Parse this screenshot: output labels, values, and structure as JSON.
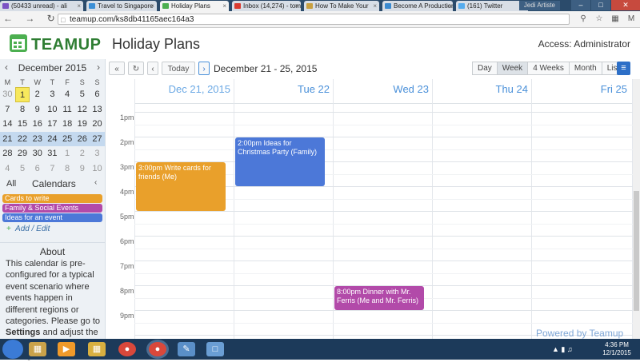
{
  "browser": {
    "tabs": [
      {
        "label": "(50433 unread) - ali",
        "icon_color": "#7b52c4"
      },
      {
        "label": "Travel to Singapore",
        "icon_color": "#3b8fd6"
      },
      {
        "label": "Holiday Plans",
        "icon_color": "#4caf50",
        "active": true
      },
      {
        "label": "Inbox (14,274) - tom",
        "icon_color": "#d93b30"
      },
      {
        "label": "How To Make Your",
        "icon_color": "#c8a040"
      },
      {
        "label": "Become A Production",
        "icon_color": "#3a8ad0"
      },
      {
        "label": "(161) Twitter",
        "icon_color": "#55acee"
      }
    ],
    "user_chip": "Jedi Artiste",
    "url": "teamup.com/ks8db41165aec164a3",
    "nav": "← → ↻"
  },
  "app": {
    "brand": "TEAMUP",
    "calendar_title": "Holiday Plans",
    "access": "Access: Administrator"
  },
  "mini_calendar": {
    "month_label": "December 2015",
    "prev": "‹",
    "next": "›",
    "weekdays": [
      "M",
      "T",
      "W",
      "T",
      "F",
      "S",
      "S"
    ],
    "weeks": [
      [
        "30",
        "1",
        "2",
        "3",
        "4",
        "5",
        "6"
      ],
      [
        "7",
        "8",
        "9",
        "10",
        "11",
        "12",
        "13"
      ],
      [
        "14",
        "15",
        "16",
        "17",
        "18",
        "19",
        "20"
      ],
      [
        "21",
        "22",
        "23",
        "24",
        "25",
        "26",
        "27"
      ],
      [
        "28",
        "29",
        "30",
        "31",
        "1",
        "2",
        "3"
      ],
      [
        "4",
        "5",
        "6",
        "7",
        "8",
        "9",
        "10"
      ]
    ],
    "today": "1"
  },
  "calendars": {
    "all_label": "All",
    "title": "Calendars",
    "toggle": "‹",
    "items": [
      {
        "label": "Cards to write",
        "color": "#e9a02b"
      },
      {
        "label": "Family & Social Events",
        "color": "#b24aa9"
      },
      {
        "label": "Ideas for an event",
        "color": "#4c78d8"
      }
    ],
    "add_edit": "Add / Edit"
  },
  "about": {
    "title": "About",
    "text_before": "This calendar is pre-configured for a typical event scenario where events happen in different regions or categories. Please go to ",
    "settings_word": "Settings",
    "text_after": " and adjust the following configuration settings to"
  },
  "toolbar": {
    "collapse": "«",
    "refresh": "↻",
    "prev": "‹",
    "today": "Today",
    "next": "›",
    "range": "December 21 - 25, 2015",
    "views": [
      "Day",
      "Week",
      "4 Weeks",
      "Month",
      "List"
    ],
    "active_view": "Week",
    "menu": "≡"
  },
  "week": {
    "days": [
      "Dec 21, 2015",
      "Tue 22",
      "Wed 23",
      "Thu 24",
      "Fri 25"
    ],
    "hours": [
      "1pm",
      "2pm",
      "3pm",
      "4pm",
      "5pm",
      "6pm",
      "7pm",
      "8pm",
      "9pm"
    ],
    "events": [
      {
        "day": 0,
        "start": 15,
        "end": 17,
        "title": "3:00pm Write cards for friends (Me)",
        "color": "#e9a02b"
      },
      {
        "day": 1,
        "start": 14,
        "end": 16,
        "title": "2:00pm Ideas for Christmas Party (Family)",
        "color": "#4c78d8"
      },
      {
        "day": 2,
        "start": 20,
        "end": 21,
        "title": "8:00pm Dinner with Mr. Ferris (Me and Mr. Ferris)",
        "color": "#b24aa9"
      }
    ],
    "powered": "Powered by Teamup"
  },
  "taskbar": {
    "clock_time": "4:36 PM",
    "clock_date": "12/1/2015"
  }
}
